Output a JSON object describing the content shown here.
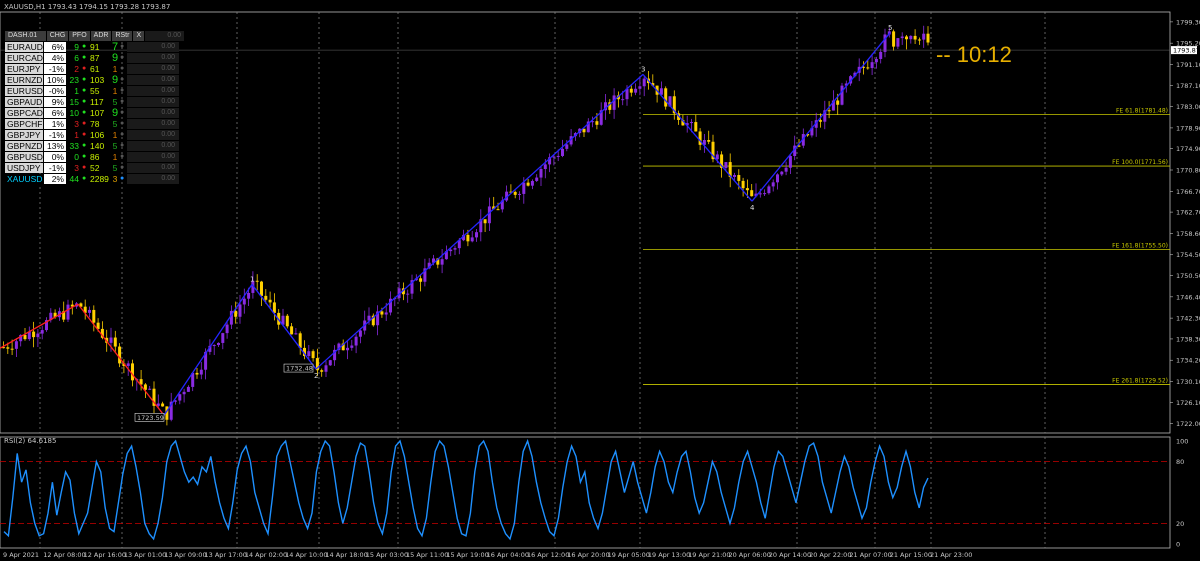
{
  "header": {
    "symbol_info": "XAUUSD,H1  1793.43 1794.15 1793.28 1793.87"
  },
  "clock": "--  10:12",
  "dashboard": {
    "title": "DASH.01",
    "columns": [
      "CHG",
      "PFO",
      "ADR",
      "RStr",
      "X"
    ],
    "header_value": "0.00",
    "rows": [
      {
        "sym": "EURAUD",
        "chg": "6%",
        "pfo": "9",
        "dot": "green",
        "adr": "91",
        "rs": "7",
        "val": "0.00"
      },
      {
        "sym": "EURCAD",
        "chg": "4%",
        "pfo": "6",
        "dot": "green",
        "adr": "87",
        "rs": "9",
        "val": "0.00"
      },
      {
        "sym": "EURJPY",
        "chg": "-1%",
        "pfo": "2",
        "dot": "red",
        "adr": "61",
        "rs": "1",
        "val": "0.00"
      },
      {
        "sym": "EURNZD",
        "chg": "10%",
        "pfo": "23",
        "dot": "green",
        "adr": "103",
        "rs": "9",
        "val": "0.00"
      },
      {
        "sym": "EURUSD",
        "chg": "-0%",
        "pfo": "1",
        "dot": "green",
        "adr": "55",
        "rs": "1",
        "val": "0.00"
      },
      {
        "sym": "GBPAUD",
        "chg": "9%",
        "pfo": "15",
        "dot": "green",
        "adr": "117",
        "rs": "5",
        "val": "0.00"
      },
      {
        "sym": "GBPCAD",
        "chg": "6%",
        "pfo": "10",
        "dot": "green",
        "adr": "107",
        "rs": "9",
        "val": "0.00"
      },
      {
        "sym": "GBPCHF",
        "chg": "1%",
        "pfo": "3",
        "dot": "red",
        "adr": "78",
        "rs": "5",
        "val": "0.00"
      },
      {
        "sym": "GBPJPY",
        "chg": "-1%",
        "pfo": "1",
        "dot": "red",
        "adr": "106",
        "rs": "1",
        "val": "0.00"
      },
      {
        "sym": "GBPNZD",
        "chg": "13%",
        "pfo": "33",
        "dot": "green",
        "adr": "140",
        "rs": "5",
        "val": "0.00"
      },
      {
        "sym": "GBPUSD",
        "chg": "0%",
        "pfo": "0",
        "dot": "green",
        "adr": "86",
        "rs": "1",
        "val": "0.00"
      },
      {
        "sym": "USDJPY",
        "chg": "-1%",
        "pfo": "3",
        "dot": "red",
        "adr": "52",
        "rs": "5",
        "val": "0.00"
      },
      {
        "sym": "XAUUSD",
        "chg": "2%",
        "pfo": "44",
        "dot": "green",
        "adr": "2289",
        "rs": "3",
        "val": "0.00"
      }
    ]
  },
  "colors": {
    "bull": "#8a2be2",
    "bear": "#ffd000",
    "zigzag_blue": "#2525ff",
    "zigzag_red": "#ff2020",
    "fib": "#c8c800",
    "rsi": "#1e90ff",
    "rsi_level": "#c80000"
  },
  "chart_data": [
    {
      "type": "candlestick",
      "title": "XAUUSD,H1",
      "ylim": [
        1720.2,
        1801.2
      ],
      "y_ticks": [
        "1799.30",
        "1795.20",
        "1791.10",
        "1787.10",
        "1783.00",
        "1778.90",
        "1774.90",
        "1770.80",
        "1766.70",
        "1762.70",
        "1758.60",
        "1754.50",
        "1750.50",
        "1746.40",
        "1742.30",
        "1738.30",
        "1734.20",
        "1730.10",
        "1726.10",
        "1722.00"
      ],
      "price_tag": "1793.87",
      "x_ticks": [
        "9 Apr 2021",
        "12 Apr 08:00",
        "12 Apr 16:00",
        "13 Apr 01:00",
        "13 Apr 09:00",
        "13 Apr 17:00",
        "14 Apr 02:00",
        "14 Apr 10:00",
        "14 Apr 18:00",
        "15 Apr 03:00",
        "15 Apr 11:00",
        "15 Apr 19:00",
        "16 Apr 04:00",
        "16 Apr 12:00",
        "16 Apr 20:00",
        "19 Apr 05:00",
        "19 Apr 13:00",
        "19 Apr 21:00",
        "20 Apr 06:00",
        "20 Apr 14:00",
        "20 Apr 22:00",
        "21 Apr 07:00",
        "21 Apr 15:00",
        "21 Apr 23:00"
      ],
      "zigzag": [
        {
          "label": "",
          "price": 1736.5
        },
        {
          "label": "",
          "price": 1745.0
        },
        {
          "label": "",
          "price": 1723.6
        },
        {
          "label": "1",
          "price": 1748.8
        },
        {
          "label": "2",
          "price": 1732.5
        },
        {
          "label": "3",
          "price": 1789.2
        },
        {
          "label": "4",
          "price": 1764.8
        },
        {
          "label": "5",
          "price": 1797.2
        }
      ],
      "price_labels": [
        "1723.59",
        "1732.48"
      ],
      "fibonacci": [
        {
          "label": "FE 61.8(1781.48)",
          "price": 1781.48
        },
        {
          "label": "FE 100.0(1771.56)",
          "price": 1771.56
        },
        {
          "label": "FE 161.8(1755.50)",
          "price": 1755.5
        },
        {
          "label": "FE 261.8(1729.52)",
          "price": 1729.52
        }
      ]
    },
    {
      "type": "line",
      "title": "RSI(2) 64.6185",
      "ylim": [
        0,
        100
      ],
      "levels": [
        20,
        80
      ],
      "y_ticks": [
        "100",
        "80",
        "20",
        "0"
      ],
      "values": [
        12,
        8,
        45,
        88,
        60,
        72,
        40,
        20,
        8,
        10,
        30,
        60,
        28,
        50,
        70,
        62,
        30,
        10,
        20,
        30,
        55,
        80,
        70,
        35,
        15,
        12,
        40,
        68,
        88,
        95,
        75,
        50,
        20,
        10,
        5,
        20,
        45,
        80,
        95,
        100,
        85,
        70,
        60,
        65,
        58,
        75,
        70,
        85,
        60,
        40,
        25,
        15,
        40,
        72,
        88,
        95,
        80,
        50,
        35,
        20,
        10,
        45,
        85,
        95,
        100,
        80,
        60,
        40,
        25,
        15,
        30,
        70,
        90,
        100,
        95,
        70,
        40,
        20,
        35,
        60,
        85,
        98,
        95,
        70,
        40,
        20,
        10,
        30,
        70,
        95,
        100,
        85,
        60,
        35,
        15,
        8,
        25,
        60,
        90,
        100,
        95,
        75,
        50,
        25,
        10,
        8,
        30,
        70,
        95,
        100,
        90,
        60,
        35,
        20,
        10,
        5,
        20,
        60,
        90,
        100,
        85,
        60,
        40,
        25,
        12,
        8,
        25,
        55,
        80,
        95,
        85,
        60,
        70,
        40,
        25,
        15,
        30,
        55,
        80,
        90,
        70,
        50,
        65,
        80,
        60,
        45,
        30,
        50,
        75,
        90,
        80,
        60,
        50,
        70,
        85,
        90,
        70,
        45,
        30,
        40,
        60,
        80,
        70,
        50,
        35,
        20,
        35,
        60,
        80,
        90,
        75,
        60,
        40,
        25,
        50,
        75,
        90,
        85,
        70,
        55,
        40,
        60,
        80,
        95,
        98,
        85,
        60,
        45,
        30,
        50,
        70,
        85,
        75,
        55,
        40,
        25,
        35,
        60,
        80,
        95,
        85,
        60,
        45,
        55,
        75,
        90,
        75,
        50,
        35,
        55,
        64
      ]
    }
  ]
}
